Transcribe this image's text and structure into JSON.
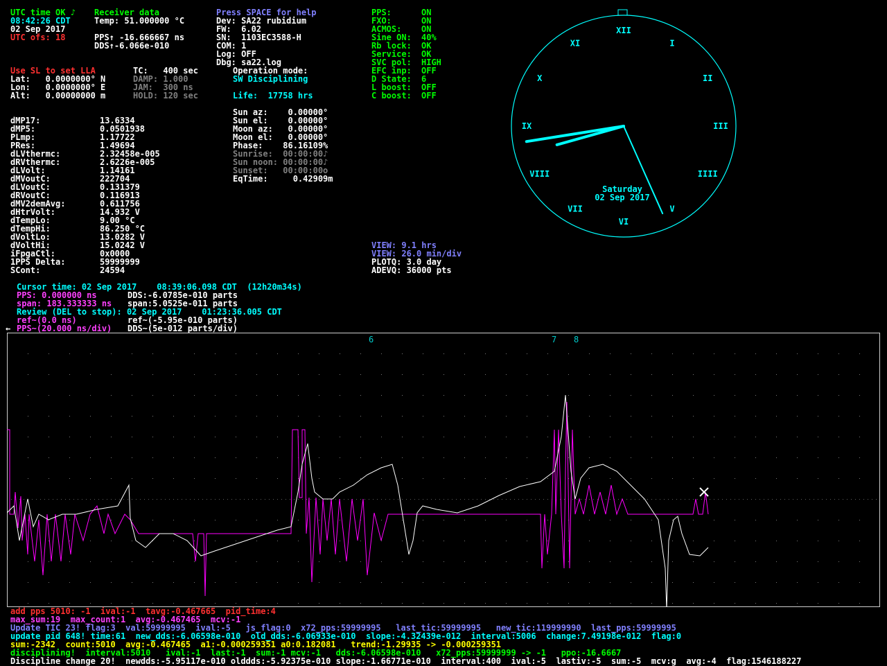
{
  "status": {
    "utc_line": "UTC time OK ♪",
    "time": "08:42:26 CDT",
    "date": "02 Sep 2017",
    "utc_ofs": "UTC ofs: 18"
  },
  "receiver": {
    "header": "Receiver data",
    "temp": "Temp: 51.000000 °C",
    "pps": "PPS↑ -16.666667 ns",
    "dds": "DDS↑-6.066e-010"
  },
  "device": {
    "help": "Press SPACE for help",
    "dev": "Dev: SA22 rubidium",
    "fw": "FW:  6.02",
    "sn": "SN:  1103EC3588-H",
    "com": "COM: 1",
    "log": "Log: OFF",
    "dbg": "Dbg: sa22.log"
  },
  "flags": {
    "labels": [
      "PPS:",
      "FXO:",
      "ACMOS:",
      "Sine ON:",
      "Rb lock:",
      "Service:",
      "SVC pol:",
      "EFC inp:",
      "D State:",
      "L boost:",
      "C boost:"
    ],
    "values": [
      "ON",
      "ON",
      "ON",
      "40%",
      "OK",
      "OK",
      "HIGH",
      "OFF",
      "6",
      "OFF",
      "OFF"
    ]
  },
  "position": {
    "use_sl": "Use SL to set LLA",
    "tc": "TC:   400 sec",
    "lat": "Lat:   0.0000000° N",
    "lon": "Lon:   0.0000000° E",
    "alt": "Alt:   0.00000000 m",
    "damp": "DAMP: 1.000",
    "jam": "JAM:  300 ns",
    "hold": "HOLD: 120 sec"
  },
  "operation": {
    "mode_label": "Operation mode:",
    "mode": "SW Disciplining",
    "life": "Life:  17758 hrs"
  },
  "astro": [
    "Sun az:    0.00000°",
    "Sun el:    0.00000°",
    "Moon az:   0.00000°",
    "Moon el:   0.00000°",
    "Phase:    86.16109%"
  ],
  "astro_dim": [
    "Sunrise:  00:00:00♪",
    "Sun noon: 00:00:00♪",
    "Sunset:   00:00:00o"
  ],
  "eqtime": "EqTime:     0.42909m",
  "params": {
    "labels": [
      "dMP17:",
      "dMP5:",
      "PLmp:",
      "PRes:",
      "dLVthermc:",
      "dRVthermc:",
      "dLVolt:",
      "dMVoutC:",
      "dLVoutC:",
      "dRVoutC:",
      "dMV2demAvg:",
      "dHtrVolt:",
      "dTempLo:",
      "dTempHi:",
      "dVoltLo:",
      "dVoltHi:",
      "iFpgaCtl:",
      "1PPS Delta:",
      "SCont:"
    ],
    "values": [
      "13.6334",
      "0.0501938",
      "1.17722",
      "1.49694",
      "2.32458e-005",
      "2.6226e-005",
      "1.14161",
      "222704",
      "0.131379",
      "0.116913",
      "0.611756",
      "14.932 V",
      "9.00 °C",
      "86.250 °C",
      "13.0282 V",
      "15.0242 V",
      "0x0000",
      "59999999",
      "24594"
    ]
  },
  "view": {
    "view_hrs": "VIEW: 9.1 hrs",
    "view_div": "VIEW: 26.0 min/div",
    "plotq": "PLOTQ: 3.0 day",
    "adevq": "ADEVQ: 36000 pts"
  },
  "clock": {
    "numerals": [
      "XII",
      "I",
      "II",
      "III",
      "IIII",
      "V",
      "VI",
      "VII",
      "VIII",
      "IX",
      "X",
      "XI"
    ],
    "day": "Saturday",
    "date": "02 Sep 2017",
    "hour": 8.7,
    "minute": 42.4,
    "second": 26
  },
  "cursor": {
    "time": "Cursor time: 02 Sep 2017    08:39:06.098 CDT  (12h20m34s)",
    "pps": "PPS: 0.000000 ns",
    "dds": "DDS:-6.0785e-010 parts",
    "span": "span: 183.333333 ns",
    "span_dds": "span:5.0525e-011 parts",
    "review": "Review (DEL to stop): 02 Sep 2017    01:23:36.005 CDT",
    "ref": "ref~(0.0 ns)",
    "ref_dds": "ref~(-5.95e-010 parts)",
    "pps_scale": "PPS~(20.000 ns/div)",
    "dds_scale": "DDS~(5e-012 parts/div)",
    "arrow": "←"
  },
  "plot_markers": [
    "6",
    "7",
    "8"
  ],
  "debug": {
    "line1": "add pps 5010: -1  ival:-1  tavg:-0.467665  pid_time:4",
    "line2": "max_sum:19  max_count:1  avg:-0.467465  mcv:-1",
    "line3": "Update TIC 23! flag:3  val:59999995  ival:-5   js_flag:0  x72_pps:59999995   last_tic:59999995   new_tic:119999990  last_pps:59999995",
    "line4": "update pid 648! time:61  new_dds:-6.06598e-010  old_dds:-6.06933e-010  slope:-4.32439e-012  interval:5006  change:7.49198e-012  flag:0",
    "line5": "sum:-2342  count:5010  avg:-0.467465  a1:-0.000259351 a0:0.182081   trend:-1.29935 -> -0.000259351",
    "line6": "disciplining!  interval:5010   ival:-1  last:-1  sum:-1 mcv:-1   dds:-6.06598e-010   x72_pps:59999999 -> -1   ppo:-16.6667",
    "line7": "Discipline change 20!  newdds:-5.95117e-010 olddds:-5.92375e-010 slope:-1.66771e-010  interval:400  ival:-5  lastiv:-5  sum:-5  mcv:g  avg:-4  flag:1546188227"
  },
  "colors": {
    "background": "#000000",
    "pps_trace": "#ff00ff",
    "dds_trace": "#ffffff",
    "clock": "#00ffff",
    "grid": "#7a7a7a"
  }
}
